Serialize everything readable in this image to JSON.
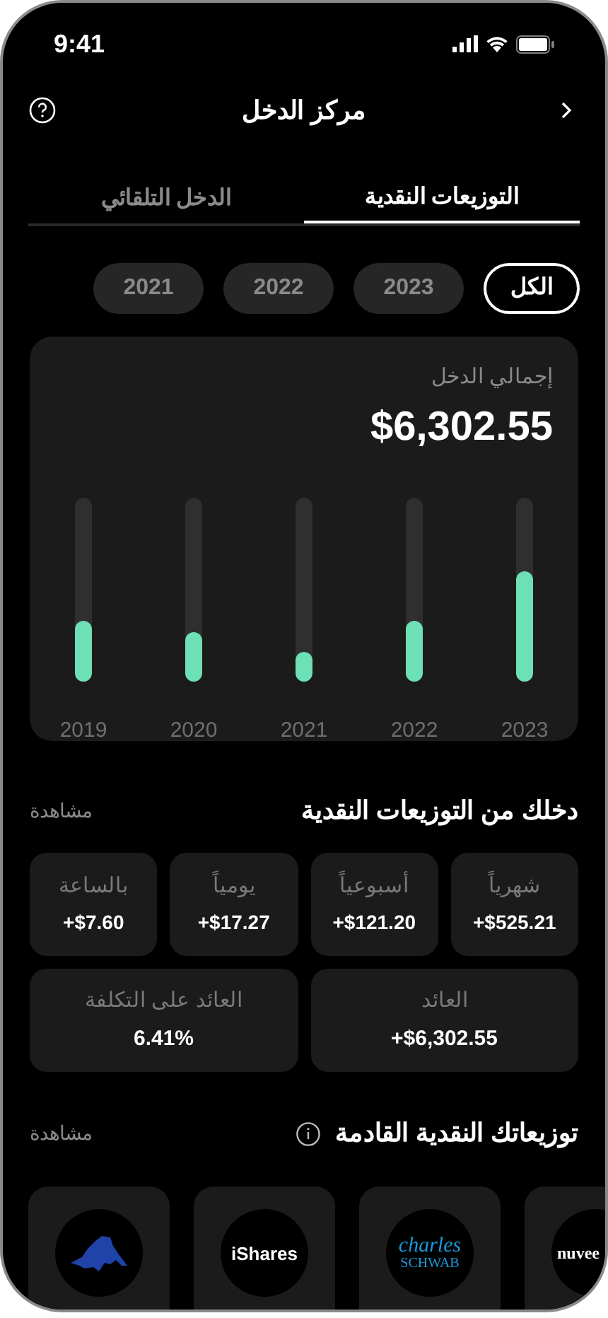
{
  "status_bar": {
    "time": "9:41"
  },
  "header": {
    "title": "مركز الدخل"
  },
  "tabs": [
    {
      "label": "التوزيعات النقدية",
      "selected": true
    },
    {
      "label": "الدخل التلقائي",
      "selected": false
    }
  ],
  "filters": [
    {
      "label": "الكل",
      "selected": true
    },
    {
      "label": "2023",
      "selected": false
    },
    {
      "label": "2022",
      "selected": false
    },
    {
      "label": "2021",
      "selected": false
    }
  ],
  "total_card": {
    "label": "إجمالي الدخل",
    "value": "$6,302.55",
    "bars": [
      {
        "year": "2023",
        "level": 0.6
      },
      {
        "year": "2022",
        "level": 0.33
      },
      {
        "year": "2021",
        "level": 0.16
      },
      {
        "year": "2020",
        "level": 0.27
      },
      {
        "year": "2019",
        "level": 0.33
      }
    ]
  },
  "income_section": {
    "title": "دخلك من التوزيعات النقدية",
    "link": "مشاهدة",
    "stats": [
      {
        "label": "شهرياً",
        "value": "+$525.21"
      },
      {
        "label": "أسبوعياً",
        "value": "+$121.20"
      },
      {
        "label": "يومياً",
        "value": "+$17.27"
      },
      {
        "label": "بالساعة",
        "value": "+$7.60"
      },
      {
        "label": "العائد",
        "value": "+$6,302.55"
      },
      {
        "label": "العائد على التكلفة",
        "value": "6.41%"
      }
    ]
  },
  "upcoming_section": {
    "title": "توزيعاتك النقدية القادمة",
    "link": "مشاهدة",
    "funds": [
      {
        "kind": "cut",
        "lines": [
          "nuvee"
        ]
      },
      {
        "kind": "serif",
        "lines": [
          "charles",
          "SCHWAB"
        ]
      },
      {
        "kind": "wordmark",
        "lines": [
          "iShares"
        ]
      },
      {
        "kind": "mountain"
      }
    ]
  }
}
